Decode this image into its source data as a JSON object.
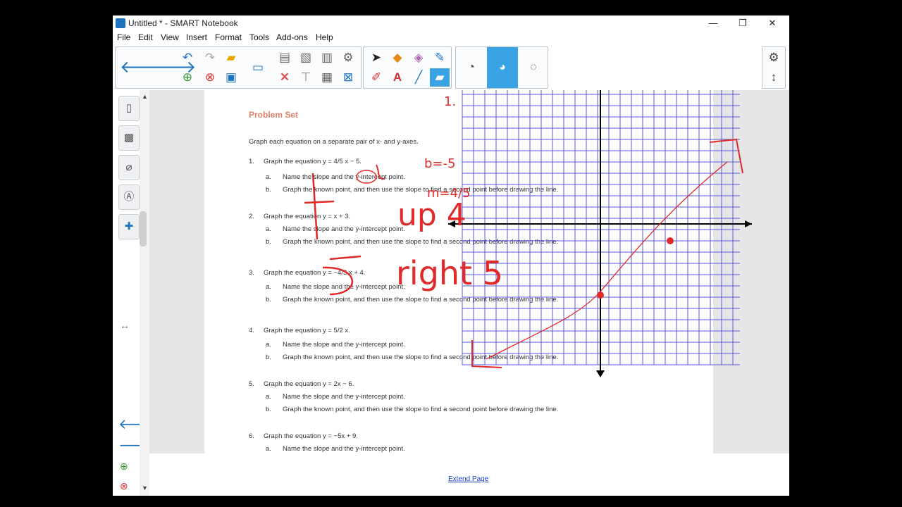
{
  "window": {
    "title": "Untitled * - SMART Notebook",
    "minimize": "—",
    "restore": "❐",
    "close": "✕"
  },
  "menu": [
    "File",
    "Edit",
    "View",
    "Insert",
    "Format",
    "Tools",
    "Add-ons",
    "Help"
  ],
  "toolbar": {
    "icons": [
      "back-arrow-icon",
      "forward-arrow-icon",
      "undo-icon",
      "redo-icon",
      "open-folder-icon",
      "add-page-icon",
      "delete-page-icon",
      "save-icon",
      "screen-display-icon",
      "paste-icon",
      "insert-picture-icon",
      "screen-capture-icon",
      "table-icon",
      "delete-icon",
      "select-icon",
      "fill-icon",
      "eraser-icon",
      "magic-pen-icon",
      "pens-icon",
      "text-icon",
      "line-icon",
      "shapes-icon",
      "properties-gear-icon",
      "toolbar-move-icon"
    ],
    "colors": {
      "accent": "#1e73be",
      "active": "#3aa3e3",
      "delete": "#e05555"
    }
  },
  "problem_set": {
    "title": "Problem Set",
    "intro": "Graph each equation on a separate pair of x- and y-axes.",
    "items": [
      {
        "num": "1.",
        "text": "Graph the equation y = 4/5 x − 5."
      },
      {
        "sub": "a.",
        "text": "Name the slope and the y-intercept point."
      },
      {
        "sub": "b.",
        "text": "Graph the known point, and then use the slope to find a second point before drawing the line."
      },
      {
        "num": "2.",
        "text": "Graph the equation y = x + 3."
      },
      {
        "sub": "a.",
        "text": "Name the slope and the y-intercept point."
      },
      {
        "sub": "b.",
        "text": "Graph the known point, and then use the slope to find a second point before drawing the line."
      },
      {
        "num": "3.",
        "text": "Graph the equation y = −4/3 x + 4."
      },
      {
        "sub": "a.",
        "text": "Name the slope and the y-intercept point."
      },
      {
        "sub": "b.",
        "text": "Graph the known point, and then use the slope to find a second point before drawing the line."
      },
      {
        "num": "4.",
        "text": "Graph the equation y = 5/2 x."
      },
      {
        "sub": "a.",
        "text": "Name the slope and the y-intercept point."
      },
      {
        "sub": "b.",
        "text": "Graph the known point, and then use the slope to find a second point before drawing the line."
      },
      {
        "num": "5.",
        "text": "Graph the equation y = 2x − 6."
      },
      {
        "sub": "a.",
        "text": "Name the slope and the y-intercept point."
      },
      {
        "sub": "b.",
        "text": "Graph the known point, and then use the slope to find a second point before drawing the line."
      },
      {
        "num": "6.",
        "text": "Graph the equation y = −5x + 9."
      },
      {
        "sub": "a.",
        "text": "Name the slope and the y-intercept point."
      }
    ]
  },
  "annotations": {
    "b": "b=-5",
    "m": "m=4/5",
    "up": "up 4",
    "right": "right 5",
    "num": "1."
  },
  "extend_page": "Extend Page",
  "sidebar": {
    "tabs": [
      "page-sorter-icon",
      "gallery-icon",
      "attachments-icon",
      "properties-icon",
      "add-ons-icon"
    ],
    "resize": "↔"
  }
}
